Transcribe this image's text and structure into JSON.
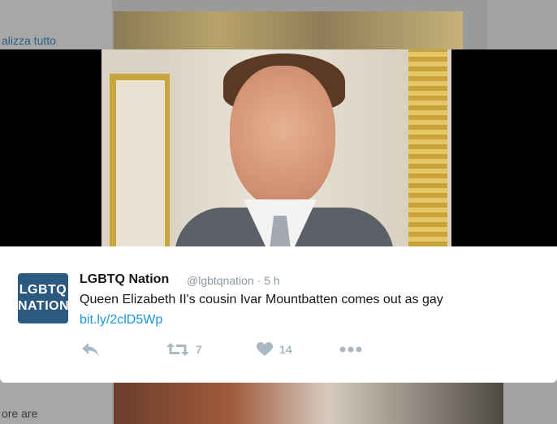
{
  "background": {
    "left_text_top": "alizza tutto",
    "left_text_bottom": "ore are"
  },
  "tweet": {
    "avatar_line1": "LGBTQ",
    "avatar_line2": "NATION",
    "name": "LGBTQ Nation",
    "handle": "@lgbtqnation",
    "separator": "·",
    "time": "5 h",
    "text": "Queen Elizabeth II's cousin Ivar Mountbatten comes out as gay",
    "link": "bit.ly/2clD5Wp",
    "retweets": "7",
    "likes": "14"
  },
  "icons": {
    "reply": "reply-icon",
    "retweet": "retweet-icon",
    "like": "heart-icon",
    "more": "more-icon"
  },
  "colors": {
    "avatar_bg": "#2c5980",
    "link": "#1b95e0",
    "action_gray": "#aab8c2",
    "media_band": "#000000"
  }
}
